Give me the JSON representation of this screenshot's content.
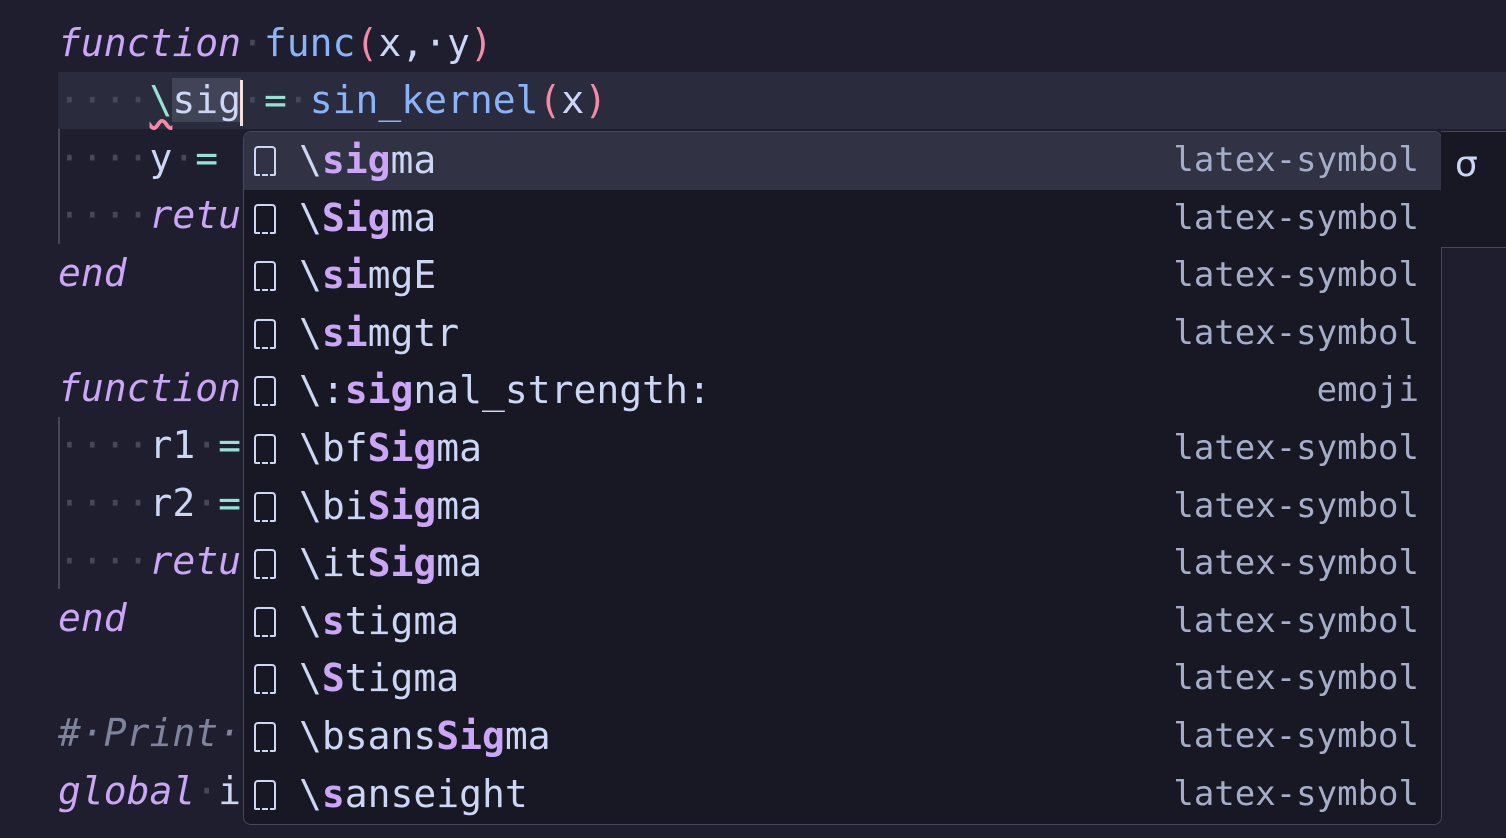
{
  "editor": {
    "lines": {
      "l1": {
        "kw": "function",
        "name": "func",
        "open": "(",
        "params": "x,·y",
        "close": ")"
      },
      "l2": {
        "backslash": "\\",
        "typed": "sig",
        "eq": "=",
        "call": "sin_kernel",
        "open": "(",
        "arg": "x",
        "close": ")"
      },
      "l3": {
        "var": "y",
        "eq": "="
      },
      "l4": {
        "kw": "retu"
      },
      "l5": {
        "kw": "end"
      },
      "l6": {
        "kw": "function"
      },
      "l7": {
        "var": "r1",
        "eq": "="
      },
      "l8": {
        "var": "r2",
        "eq": "="
      },
      "l9": {
        "kw": "retu"
      },
      "l10": {
        "kw": "end"
      },
      "l11": {
        "comment": "#·Print·"
      },
      "l12": {
        "kw": "global",
        "rest": "i"
      }
    },
    "ws_dot": "·"
  },
  "suggestions": [
    {
      "pre": "\\",
      "match": "sig",
      "post": "ma",
      "kind": "latex-symbol",
      "selected": true
    },
    {
      "pre": "\\",
      "match": "Sig",
      "post": "ma",
      "kind": "latex-symbol"
    },
    {
      "pre": "\\",
      "match": "si",
      "post": "mgE",
      "kind": "latex-symbol"
    },
    {
      "pre": "\\",
      "match": "si",
      "post": "mgtr",
      "kind": "latex-symbol"
    },
    {
      "pre": "\\:",
      "match": "sig",
      "post": "nal_strength:",
      "kind": "emoji"
    },
    {
      "pre": "\\bf",
      "match": "Sig",
      "post": "ma",
      "kind": "latex-symbol"
    },
    {
      "pre": "\\bi",
      "match": "Sig",
      "post": "ma",
      "kind": "latex-symbol"
    },
    {
      "pre": "\\it",
      "match": "Sig",
      "post": "ma",
      "kind": "latex-symbol"
    },
    {
      "pre": "\\",
      "match": "s",
      "post": "tigma",
      "kind": "latex-symbol"
    },
    {
      "pre": "\\",
      "match": "S",
      "post": "tigma",
      "kind": "latex-symbol"
    },
    {
      "pre": "\\bsans",
      "match": "Sig",
      "post": "ma",
      "kind": "latex-symbol"
    },
    {
      "pre": "\\",
      "match": "s",
      "post": "anseight",
      "kind": "latex-symbol"
    }
  ],
  "details": {
    "text": "σ"
  },
  "icons": {
    "suggestion_item": "symbol-snippet-icon"
  },
  "colors": {
    "background": "#1e1e2e",
    "keyword": "#cba6f7",
    "function": "#89b4fa",
    "paren": "#f38ba8",
    "operator": "#94e2d5",
    "comment": "#7f849c",
    "widget_bg": "#181825",
    "widget_selected": "#313244"
  }
}
